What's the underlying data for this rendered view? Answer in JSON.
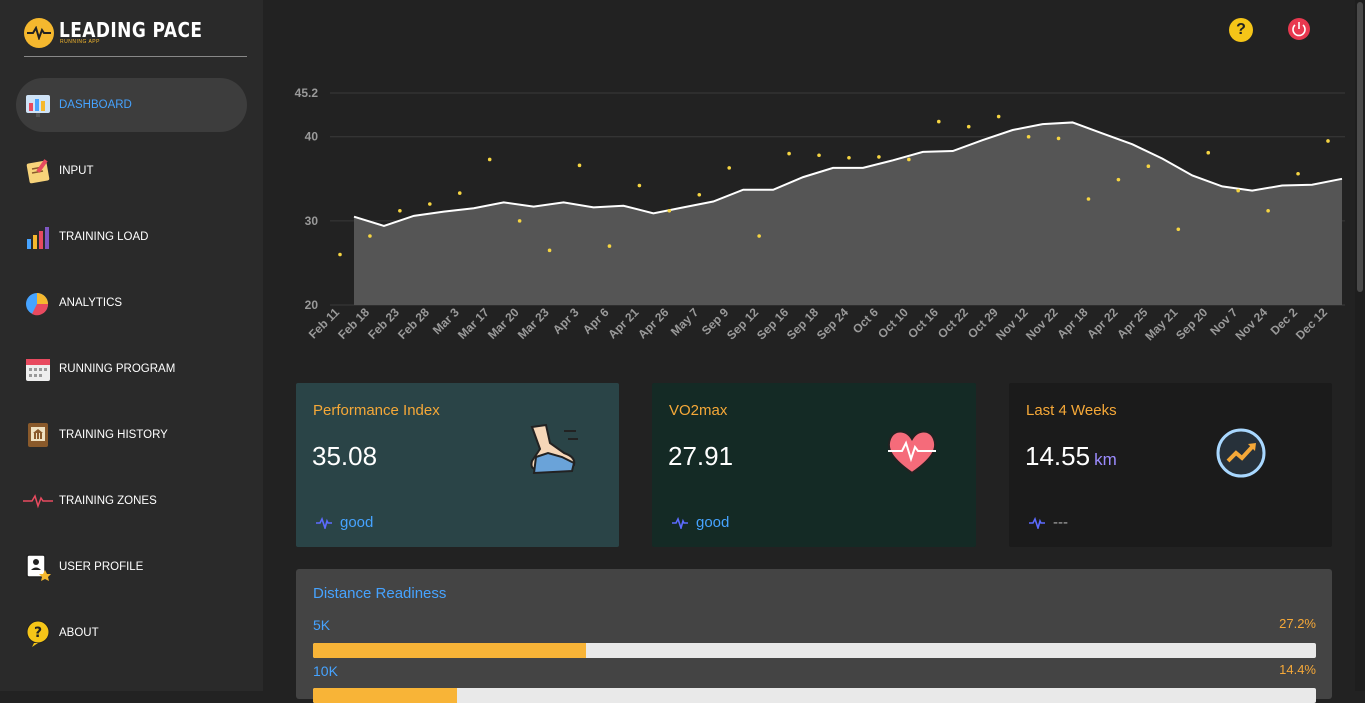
{
  "app": {
    "title": "LEADING PACE",
    "subtitle": "RUNNING APP"
  },
  "sidebar": {
    "items": [
      {
        "label": "DASHBOARD",
        "icon": "dashboard-icon",
        "active": true
      },
      {
        "label": "INPUT",
        "icon": "notepad-icon"
      },
      {
        "label": "TRAINING LOAD",
        "icon": "bar-chart-icon"
      },
      {
        "label": "ANALYTICS",
        "icon": "pie-chart-icon"
      },
      {
        "label": "RUNNING PROGRAM",
        "icon": "calendar-icon"
      },
      {
        "label": "TRAINING HISTORY",
        "icon": "history-book-icon"
      },
      {
        "label": "TRAINING ZONES",
        "icon": "heartbeat-icon"
      },
      {
        "label": "USER PROFILE",
        "icon": "user-badge-icon"
      },
      {
        "label": "ABOUT",
        "icon": "question-icon"
      }
    ]
  },
  "header": {
    "help_icon": "help-icon",
    "power_icon": "power-icon",
    "help_glyph": "?"
  },
  "cards": [
    {
      "title": "Performance Index",
      "value": "35.08",
      "unit": "",
      "status": "good",
      "icon": "running-shoe-icon",
      "bg": "#2a4447"
    },
    {
      "title": "VO2max",
      "value": "27.91",
      "unit": "",
      "status": "good",
      "icon": "heart-pulse-icon",
      "bg": "#142a25"
    },
    {
      "title": "Last 4 Weeks",
      "value": "14.55",
      "unit": "km",
      "status": "---",
      "icon": "trend-up-icon",
      "bg": "#1b1b1b"
    }
  ],
  "readiness": {
    "title": "Distance Readiness",
    "rows": [
      {
        "label": "5K",
        "pct_text": "27.2%",
        "value": 27.2
      },
      {
        "label": "10K",
        "pct_text": "14.4%",
        "value": 14.4
      }
    ]
  },
  "chart_data": {
    "type": "area",
    "title": "",
    "xlabel": "",
    "ylabel": "",
    "ylim": [
      20,
      45.2
    ],
    "yticks": [
      "45.2",
      "40",
      "30",
      "20"
    ],
    "grid": true,
    "legend": "none",
    "categories": [
      "Feb 11",
      "Feb 18",
      "Feb 23",
      "Feb 28",
      "Mar 3",
      "Mar 17",
      "Mar 20",
      "Mar 23",
      "Apr 3",
      "Apr 6",
      "Apr 21",
      "Apr 26",
      "May 7",
      "Sep 9",
      "Sep 12",
      "Sep 16",
      "Sep 18",
      "Sep 24",
      "Oct 6",
      "Oct 10",
      "Oct 16",
      "Oct 22",
      "Oct 29",
      "Nov 12",
      "Nov 22",
      "Apr 18",
      "Apr 22",
      "Apr 25",
      "May 21",
      "Sep 20",
      "Nov 7",
      "Nov 24",
      "Dec 2",
      "Dec 12"
    ],
    "series": [
      {
        "kind": "smoothed",
        "color": "#ffffff",
        "values": [
          30.5,
          29.4,
          30.6,
          31.1,
          31.5,
          32.2,
          31.7,
          32.2,
          31.6,
          31.8,
          30.9,
          31.6,
          32.3,
          33.7,
          33.7,
          35.2,
          36.3,
          36.3,
          37.2,
          38.2,
          38.3,
          39.6,
          40.8,
          41.5,
          41.7,
          40.4,
          39.1,
          37.4,
          35.4,
          34.1,
          33.6,
          34.2,
          34.3,
          35.0
        ]
      },
      {
        "kind": "points",
        "color": "#f5d442",
        "values": [
          26,
          28.2,
          31.2,
          32,
          33.3,
          37.3,
          30,
          26.5,
          36.6,
          27,
          34.2,
          31.2,
          33.1,
          36.3,
          28.2,
          38,
          37.8,
          37.5,
          37.6,
          37.3,
          41.8,
          41.2,
          42.4,
          40,
          39.8,
          32.6,
          34.9,
          36.5,
          29,
          38.1,
          33.6,
          31.2,
          35.6,
          39.5
        ]
      }
    ]
  }
}
